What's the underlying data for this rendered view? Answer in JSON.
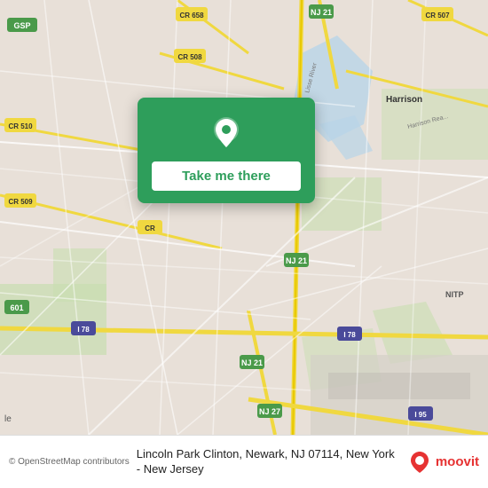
{
  "map": {
    "background_color": "#e8e0d8",
    "center_lat": 40.725,
    "center_lng": -74.18
  },
  "location_card": {
    "button_label": "Take me there",
    "pin_color": "#ffffff",
    "card_color": "#2e9e5b"
  },
  "bottom_bar": {
    "attribution": "© OpenStreetMap contributors",
    "location_text": "Lincoln Park Clinton, Newark, NJ 07114, New York - New Jersey",
    "brand_name": "moovit"
  }
}
